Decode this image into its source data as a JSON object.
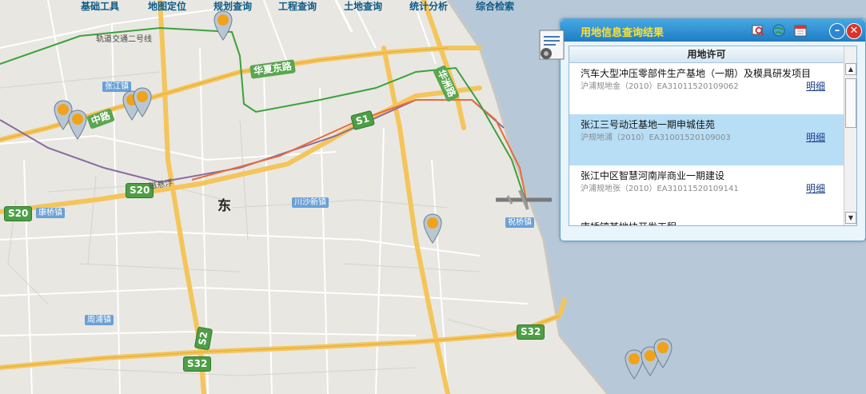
{
  "menu": [
    "基础工具",
    "地图定位",
    "规划查询",
    "工程查询",
    "土地查询",
    "统计分析",
    "综合检索"
  ],
  "map": {
    "places": [
      "轨道交通二号线",
      "张江镇",
      "川沙新镇",
      "康桥镇",
      "祝桥镇",
      "周浦镇",
      "唐镇"
    ],
    "roads": [
      "华夏东路",
      "华洲路",
      "中路",
      "S1",
      "S20",
      "S20",
      "S32",
      "S32",
      "S2",
      "磁悬浮"
    ],
    "big_char": "东"
  },
  "panel": {
    "title": "用地信息查询结果",
    "column_header": "用地许可",
    "rows": [
      {
        "title": "汽车大型冲压零部件生产基地（一期）及模具研发项目",
        "sub": "沪浦规地金（2010）EA31011520109062",
        "link": "明细"
      },
      {
        "title": "张江三号动迁基地一期申城佳苑",
        "sub": "沪规地浦（2010）EA31001520109003",
        "link": "明细"
      },
      {
        "title": "张江中区智慧河南岸商业一期建设",
        "sub": "沪浦规地张（2010）EA31011520109141",
        "link": "明细"
      },
      {
        "title": "康桥镇某地块开发工程",
        "sub": "",
        "link": ""
      }
    ],
    "icons": [
      "search-map-icon",
      "globe-icon",
      "calendar-icon",
      "minimize-icon",
      "close-icon",
      "certificate-icon"
    ]
  }
}
